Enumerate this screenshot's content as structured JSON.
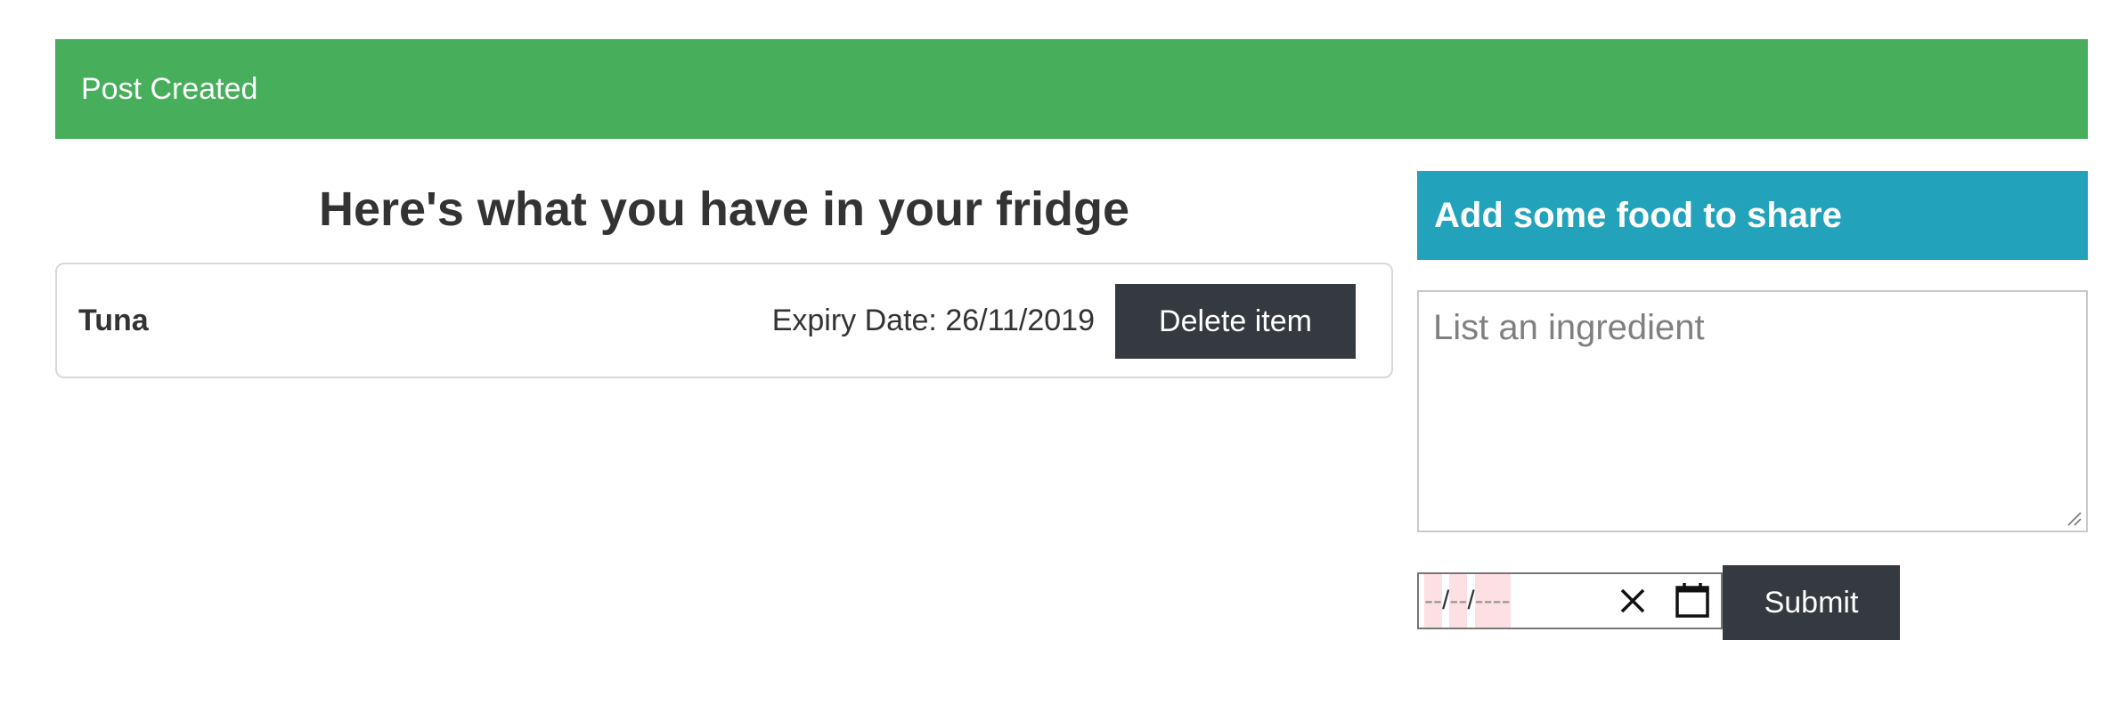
{
  "alert": {
    "text": "Post Created",
    "color": "#47af5b"
  },
  "fridge": {
    "title": "Here's what you have in your fridge",
    "items": [
      {
        "name": "Tuna",
        "expiry_label": "Expiry Date:",
        "expiry_value": "26/11/2019",
        "delete_label": "Delete item"
      }
    ]
  },
  "share": {
    "header": "Add some food to share",
    "header_color": "#22a3bb",
    "ingredient_placeholder": "List an ingredient",
    "date_placeholder": {
      "day": "--",
      "month": "--",
      "year": "----",
      "separator": "/"
    },
    "clear_icon": "close-icon",
    "calendar_icon": "calendar-icon",
    "submit_label": "Submit"
  },
  "button_color": "#343a40"
}
